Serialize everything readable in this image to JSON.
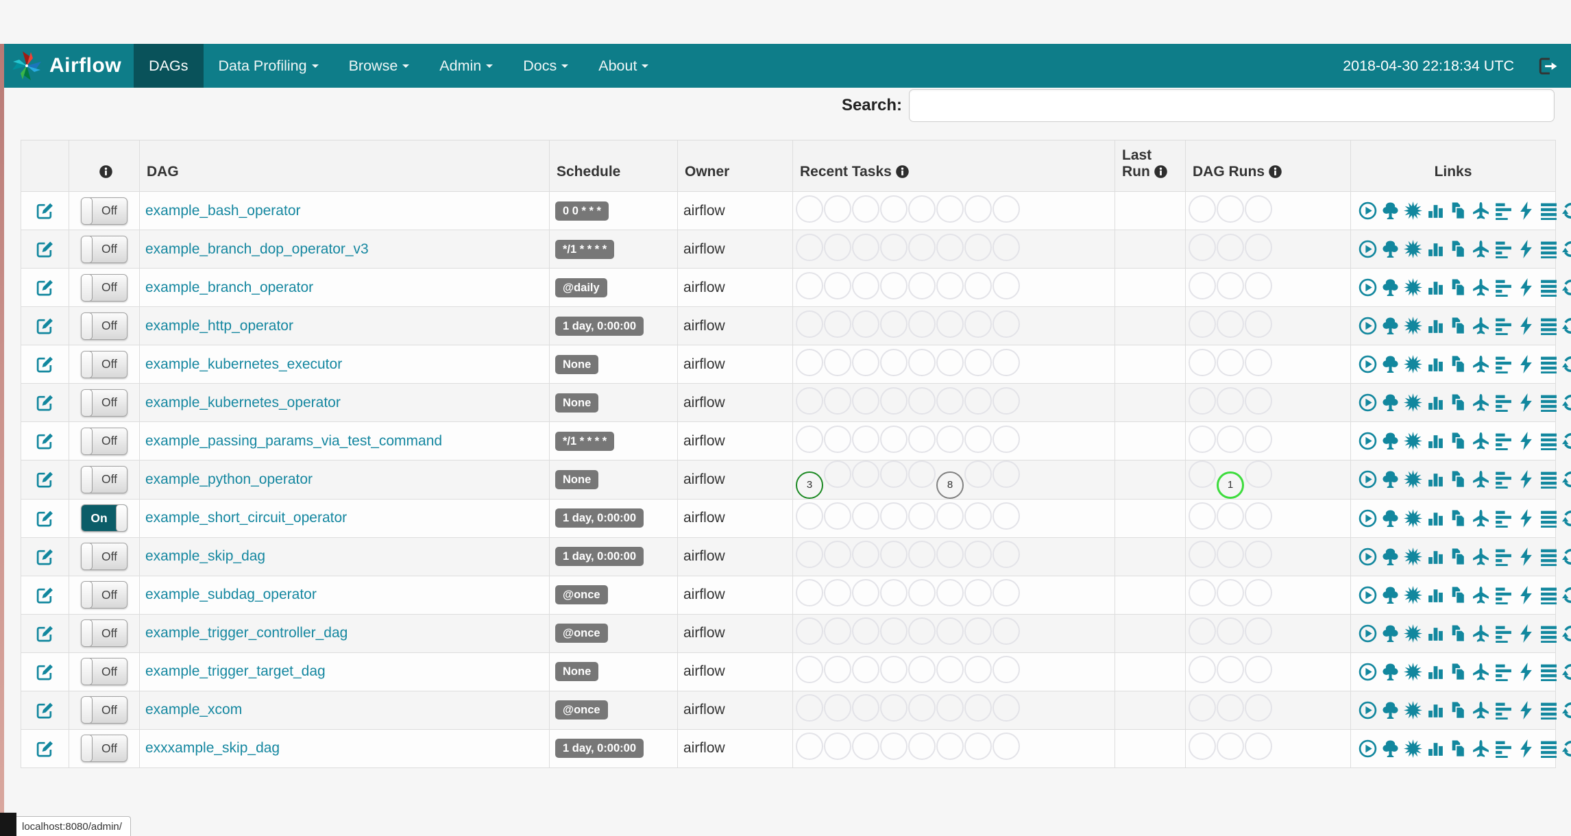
{
  "navbar": {
    "brand": "Airflow",
    "items": [
      {
        "label": "DAGs",
        "active": true,
        "caret": false
      },
      {
        "label": "Data Profiling",
        "active": false,
        "caret": true
      },
      {
        "label": "Browse",
        "active": false,
        "caret": true
      },
      {
        "label": "Admin",
        "active": false,
        "caret": true
      },
      {
        "label": "Docs",
        "active": false,
        "caret": true
      },
      {
        "label": "About",
        "active": false,
        "caret": true
      }
    ],
    "clock": "2018-04-30 22:18:34 UTC"
  },
  "page": {
    "title": "DAGs",
    "search_label": "Search:",
    "search_value": "",
    "status_bar": "localhost:8080/admin/"
  },
  "table": {
    "headers": {
      "dag": "DAG",
      "schedule": "Schedule",
      "owner": "Owner",
      "recent_tasks": "Recent Tasks",
      "last_run": "Last Run",
      "dag_runs": "DAG Runs",
      "links": "Links"
    },
    "links_order": [
      "trigger-dag",
      "tree-view",
      "graph-view",
      "task-duration",
      "task-tries",
      "landing-times",
      "gantt-view",
      "code-view",
      "logs",
      "refresh"
    ],
    "recent_task_slots": 8,
    "dag_run_slots": 3,
    "rows": [
      {
        "name": "example_bash_operator",
        "schedule": "0 0 * * *",
        "owner": "airflow",
        "toggle": "Off"
      },
      {
        "name": "example_branch_dop_operator_v3",
        "schedule": "*/1 * * * *",
        "owner": "airflow",
        "toggle": "Off"
      },
      {
        "name": "example_branch_operator",
        "schedule": "@daily",
        "owner": "airflow",
        "toggle": "Off"
      },
      {
        "name": "example_http_operator",
        "schedule": "1 day, 0:00:00",
        "owner": "airflow",
        "toggle": "Off"
      },
      {
        "name": "example_kubernetes_executor",
        "schedule": "None",
        "owner": "airflow",
        "toggle": "Off"
      },
      {
        "name": "example_kubernetes_operator",
        "schedule": "None",
        "owner": "airflow",
        "toggle": "Off"
      },
      {
        "name": "example_passing_params_via_test_command",
        "schedule": "*/1 * * * *",
        "owner": "airflow",
        "toggle": "Off"
      },
      {
        "name": "example_python_operator",
        "schedule": "None",
        "owner": "airflow",
        "toggle": "Off",
        "recent_tasks": {
          "0": {
            "state": "success",
            "count": "3"
          },
          "5": {
            "state": "queued",
            "count": "8"
          }
        },
        "dag_runs": {
          "1": {
            "state": "running",
            "count": "1"
          }
        }
      },
      {
        "name": "example_short_circuit_operator",
        "schedule": "1 day, 0:00:00",
        "owner": "airflow",
        "toggle": "On"
      },
      {
        "name": "example_skip_dag",
        "schedule": "1 day, 0:00:00",
        "owner": "airflow",
        "toggle": "Off"
      },
      {
        "name": "example_subdag_operator",
        "schedule": "@once",
        "owner": "airflow",
        "toggle": "Off"
      },
      {
        "name": "example_trigger_controller_dag",
        "schedule": "@once",
        "owner": "airflow",
        "toggle": "Off"
      },
      {
        "name": "example_trigger_target_dag",
        "schedule": "None",
        "owner": "airflow",
        "toggle": "Off"
      },
      {
        "name": "example_xcom",
        "schedule": "@once",
        "owner": "airflow",
        "toggle": "Off"
      },
      {
        "name": "exxxample_skip_dag",
        "schedule": "1 day, 0:00:00",
        "owner": "airflow",
        "toggle": "Off"
      }
    ]
  },
  "colors": {
    "navbar": "#0e7d89",
    "navbar_active": "#09525a",
    "accent_teal": "#12879e",
    "link_teal": "#1587a0",
    "badge_gray": "#777777",
    "state_success": "#1d8a24",
    "state_queued": "#818181",
    "state_running": "#3ddc3d",
    "toggle_on": "#0b5d68"
  }
}
